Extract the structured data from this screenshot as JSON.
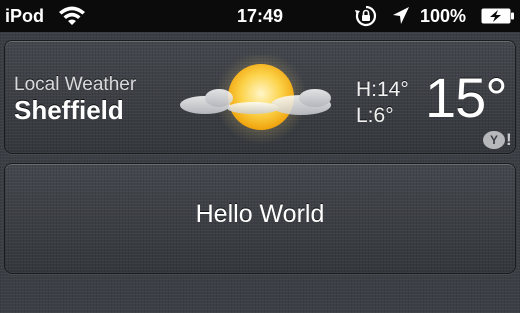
{
  "status_bar": {
    "carrier": "iPod",
    "time": "17:49",
    "battery_percent": "100%",
    "icons": [
      "wifi-icon",
      "orientation-lock-icon",
      "location-arrow-icon",
      "battery-charging-icon"
    ]
  },
  "weather_widget": {
    "label": "Local Weather",
    "city": "Sheffield",
    "condition_icon": "sun-behind-clouds-icon",
    "high": "H:14°",
    "low": "L:6°",
    "temperature": "15°",
    "provider_icon": "yahoo-logo-icon",
    "provider_mark": "Y!"
  },
  "hello_widget": {
    "text": "Hello World"
  },
  "colors": {
    "status_bar_bg": "#0b0b0c",
    "linen_bg": "#3b3e44",
    "sun_core": "#fbc02d",
    "text": "#ffffff"
  }
}
